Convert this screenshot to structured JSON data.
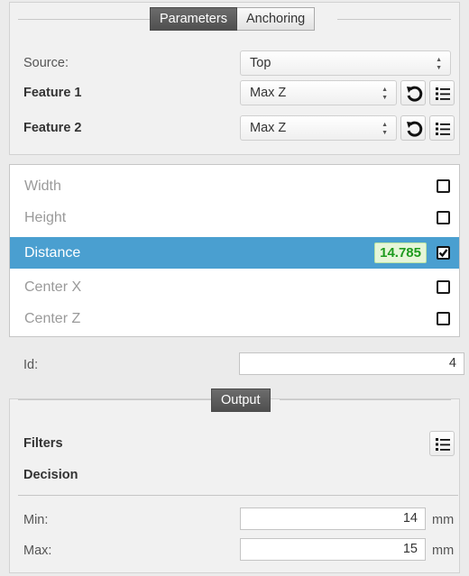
{
  "tabs": [
    {
      "label": "Parameters",
      "active": true
    },
    {
      "label": "Anchoring",
      "active": false
    }
  ],
  "params": {
    "source": {
      "label": "Source:",
      "value": "Top"
    },
    "feature1": {
      "label": "Feature 1",
      "value": "Max Z"
    },
    "feature2": {
      "label": "Feature 2",
      "value": "Max Z"
    }
  },
  "measurements": [
    {
      "label": "Width",
      "checked": false,
      "selected": false,
      "value": ""
    },
    {
      "label": "Height",
      "checked": false,
      "selected": false,
      "value": ""
    },
    {
      "label": "Distance",
      "checked": true,
      "selected": true,
      "value": "14.785"
    },
    {
      "label": "Center X",
      "checked": false,
      "selected": false,
      "value": ""
    },
    {
      "label": "Center Z",
      "checked": false,
      "selected": false,
      "value": ""
    }
  ],
  "id_field": {
    "label": "Id:",
    "value": "4"
  },
  "output": {
    "tab_label": "Output",
    "filters_label": "Filters",
    "decision_label": "Decision",
    "min": {
      "label": "Min:",
      "value": "14",
      "unit": "mm"
    },
    "max": {
      "label": "Max:",
      "value": "15",
      "unit": "mm"
    }
  },
  "colors": {
    "selection": "#4a9fd0",
    "value_text": "#1e9b1e",
    "value_bg": "#e6f6d8",
    "active_tab": "#5a5a5a"
  },
  "icons": {
    "reset": "reset-icon",
    "list": "list-icon",
    "select_arrow": "updown-arrow-icon",
    "checkbox": "checkbox-icon"
  }
}
